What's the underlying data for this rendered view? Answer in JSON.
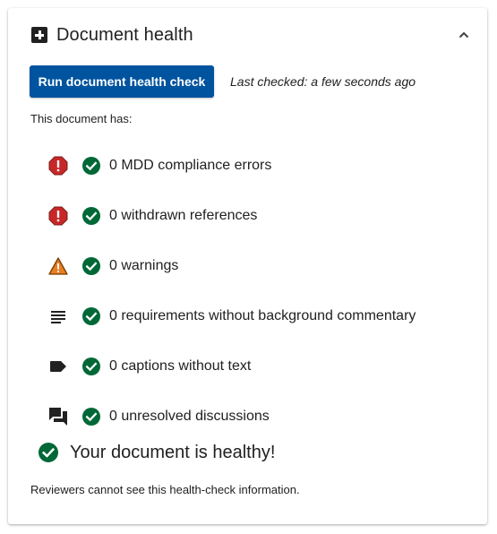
{
  "panel": {
    "title": "Document health",
    "title_icon": "plus-box-icon",
    "collapse_icon": "chevron-up-icon"
  },
  "actions": {
    "run_label": "Run document health check",
    "last_checked": "Last checked: a few seconds ago"
  },
  "summary": {
    "intro": "This document has:",
    "items": [
      {
        "type_icon": "error-octagon-icon",
        "status_icon": "check-circle-icon",
        "label": "0 MDD compliance errors"
      },
      {
        "type_icon": "error-octagon-icon",
        "status_icon": "check-circle-icon",
        "label": "0 withdrawn references"
      },
      {
        "type_icon": "warning-triangle-icon",
        "status_icon": "check-circle-icon",
        "label": "0 warnings"
      },
      {
        "type_icon": "lines-icon",
        "status_icon": "check-circle-icon",
        "label": "0 requirements without background commentary"
      },
      {
        "type_icon": "label-tag-icon",
        "status_icon": "check-circle-icon",
        "label": "0 captions without text"
      },
      {
        "type_icon": "chat-bubbles-icon",
        "status_icon": "check-circle-icon",
        "label": "0 unresolved discussions"
      }
    ]
  },
  "result": {
    "icon": "check-circle-icon",
    "text": "Your document is healthy!"
  },
  "footer": {
    "note": "Reviewers cannot see this health-check information."
  },
  "colors": {
    "primary_button": "#00539f",
    "success": "#006837",
    "error": "#c62828",
    "warning": "#e67e22",
    "text": "#212121"
  }
}
